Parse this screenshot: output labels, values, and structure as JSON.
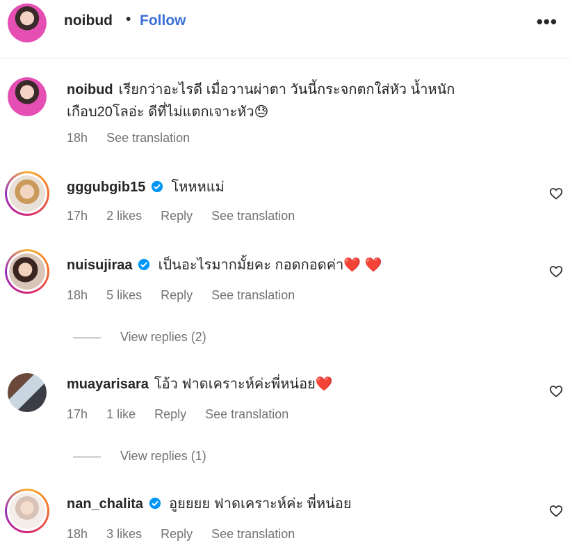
{
  "header": {
    "username": "noibud",
    "separator": "•",
    "follow_label": "Follow",
    "more_label": "•••"
  },
  "caption": {
    "username": "noibud",
    "text": "เรียกว่าอะไรดี เมื่อวานผ่าตา วันนี้กระจกตกใส่หัว น้ำหนักเกือบ20โลอ่ะ ดีที่ไม่แตกเจาะหัว😓",
    "time": "18h",
    "see_translation": "See translation"
  },
  "comments": [
    {
      "username": "gggubgib15",
      "verified": true,
      "text": "โหหหแม่",
      "time": "17h",
      "likes": "2 likes",
      "reply": "Reply",
      "see_translation": "See translation"
    },
    {
      "username": "nuisujiraa",
      "verified": true,
      "text": "เป็นอะไรมากมั้ยคะ กอดกอดค่า❤️ ❤️",
      "time": "18h",
      "likes": "5 likes",
      "reply": "Reply",
      "see_translation": "See translation",
      "view_replies": "View replies (2)"
    },
    {
      "username": "muayarisara",
      "verified": false,
      "text": "โอ้ว ฟาดเคราะห์ค่ะพี่หน่อย❤️",
      "time": "17h",
      "likes": "1 like",
      "reply": "Reply",
      "see_translation": "See translation",
      "view_replies": "View replies (1)"
    },
    {
      "username": "nan_chalita",
      "verified": true,
      "text": "อูยยยย ฟาดเคราะห์ค่ะ พี่หน่อย",
      "time": "18h",
      "likes": "3 likes",
      "reply": "Reply",
      "see_translation": "See translation"
    }
  ],
  "colors": {
    "link_blue": "#3a6fd8",
    "verified_blue": "#0095f6",
    "meta_gray": "#737373",
    "heart_red": "#e0245e"
  }
}
